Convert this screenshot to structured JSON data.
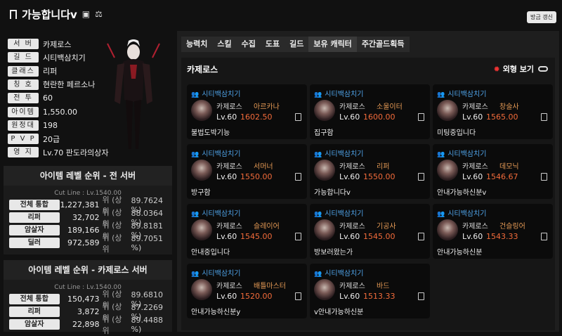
{
  "header": {
    "title": "가능합니다v",
    "refresh_label": "방금 갱신"
  },
  "profile": [
    {
      "key": "서 버",
      "value": "카제로스"
    },
    {
      "key": "길 드",
      "value": "시티백삼치기"
    },
    {
      "key": "클래스",
      "value": "리퍼"
    },
    {
      "key": "칭 호",
      "value": "현란한 페르소나"
    },
    {
      "key": "전 투",
      "value": "60"
    },
    {
      "key": "아이템",
      "value": "1,550.00"
    },
    {
      "key": "원정대",
      "value": "198"
    },
    {
      "key": "P V P",
      "value": "20급"
    },
    {
      "key": "영 지",
      "value": "Lv.70 판도라의상자"
    }
  ],
  "rank_all": {
    "title": "아이템 레벨 순위 - 전 서버",
    "cut": "Cut Line : Lv.1540.00",
    "rows": [
      {
        "label": "전체 통합",
        "rank": "1,227,381",
        "unit": "위 (상위",
        "pct": "89.7624 %)"
      },
      {
        "label": "리퍼",
        "rank": "32,702",
        "unit": "위 (상위",
        "pct": "88.0364 %)"
      },
      {
        "label": "암살자",
        "rank": "189,166",
        "unit": "위 (상위",
        "pct": "89.8181 %)"
      },
      {
        "label": "딜러",
        "rank": "972,589",
        "unit": "위 (상위",
        "pct": "89.7051 %)"
      }
    ]
  },
  "rank_server": {
    "title": "아이템 레벨 순위 - 카제로스 서버",
    "cut": "Cut Line : Lv.1540.00",
    "rows": [
      {
        "label": "전체 통합",
        "rank": "150,473",
        "unit": "위 (상위",
        "pct": "89.6810 %)"
      },
      {
        "label": "리퍼",
        "rank": "3,872",
        "unit": "위 (상위",
        "pct": "87.2269 %)"
      },
      {
        "label": "암살자",
        "rank": "22,898",
        "unit": "위 (상위",
        "pct": "89.4488 %)"
      }
    ]
  },
  "tabs": [
    "능력치",
    "스킬",
    "수집",
    "도표",
    "길드",
    "보유 캐릭터",
    "주간골드획득"
  ],
  "panel": {
    "title": "카제로스",
    "toggle_label": "외형 보기"
  },
  "characters": [
    {
      "guild": "시티백삼치기",
      "server": "카제로스",
      "cls": "아르카나",
      "lv": "Lv.60",
      "ilvl": "1602.50",
      "name": "불법도박기능"
    },
    {
      "guild": "시티백삼치기",
      "server": "카제로스",
      "cls": "소울이터",
      "lv": "Lv.60",
      "ilvl": "1600.00",
      "name": "집구함"
    },
    {
      "guild": "시티백삼치기",
      "server": "카제로스",
      "cls": "창술사",
      "lv": "Lv.60",
      "ilvl": "1565.00",
      "name": "미팅중입니다"
    },
    {
      "guild": "시티백삼치기",
      "server": "카제로스",
      "cls": "서머너",
      "lv": "Lv.60",
      "ilvl": "1550.00",
      "name": "방구함"
    },
    {
      "guild": "시티백삼치기",
      "server": "카제로스",
      "cls": "리퍼",
      "lv": "Lv.60",
      "ilvl": "1550.00",
      "name": "가능합니다v"
    },
    {
      "guild": "시티백삼치기",
      "server": "카제로스",
      "cls": "데모닉",
      "lv": "Lv.60",
      "ilvl": "1546.67",
      "name": "안내가능하신분v"
    },
    {
      "guild": "시티백삼치기",
      "server": "카제로스",
      "cls": "슬레이어",
      "lv": "Lv.60",
      "ilvl": "1545.00",
      "name": "안내중입니다"
    },
    {
      "guild": "시티백삼치기",
      "server": "카제로스",
      "cls": "기공사",
      "lv": "Lv.60",
      "ilvl": "1545.00",
      "name": "방보러왔는가"
    },
    {
      "guild": "시티백삼치기",
      "server": "카제로스",
      "cls": "건슬링어",
      "lv": "Lv.60",
      "ilvl": "1543.33",
      "name": "안내가능하신분"
    },
    {
      "guild": "시티백삼치기",
      "server": "카제로스",
      "cls": "배틀마스터",
      "lv": "Lv.60",
      "ilvl": "1520.00",
      "name": "안내가능하신분y"
    },
    {
      "guild": "시티백삼치기",
      "server": "카제로스",
      "cls": "바드",
      "lv": "Lv.60",
      "ilvl": "1513.33",
      "name": "v안내가능하신분"
    }
  ]
}
